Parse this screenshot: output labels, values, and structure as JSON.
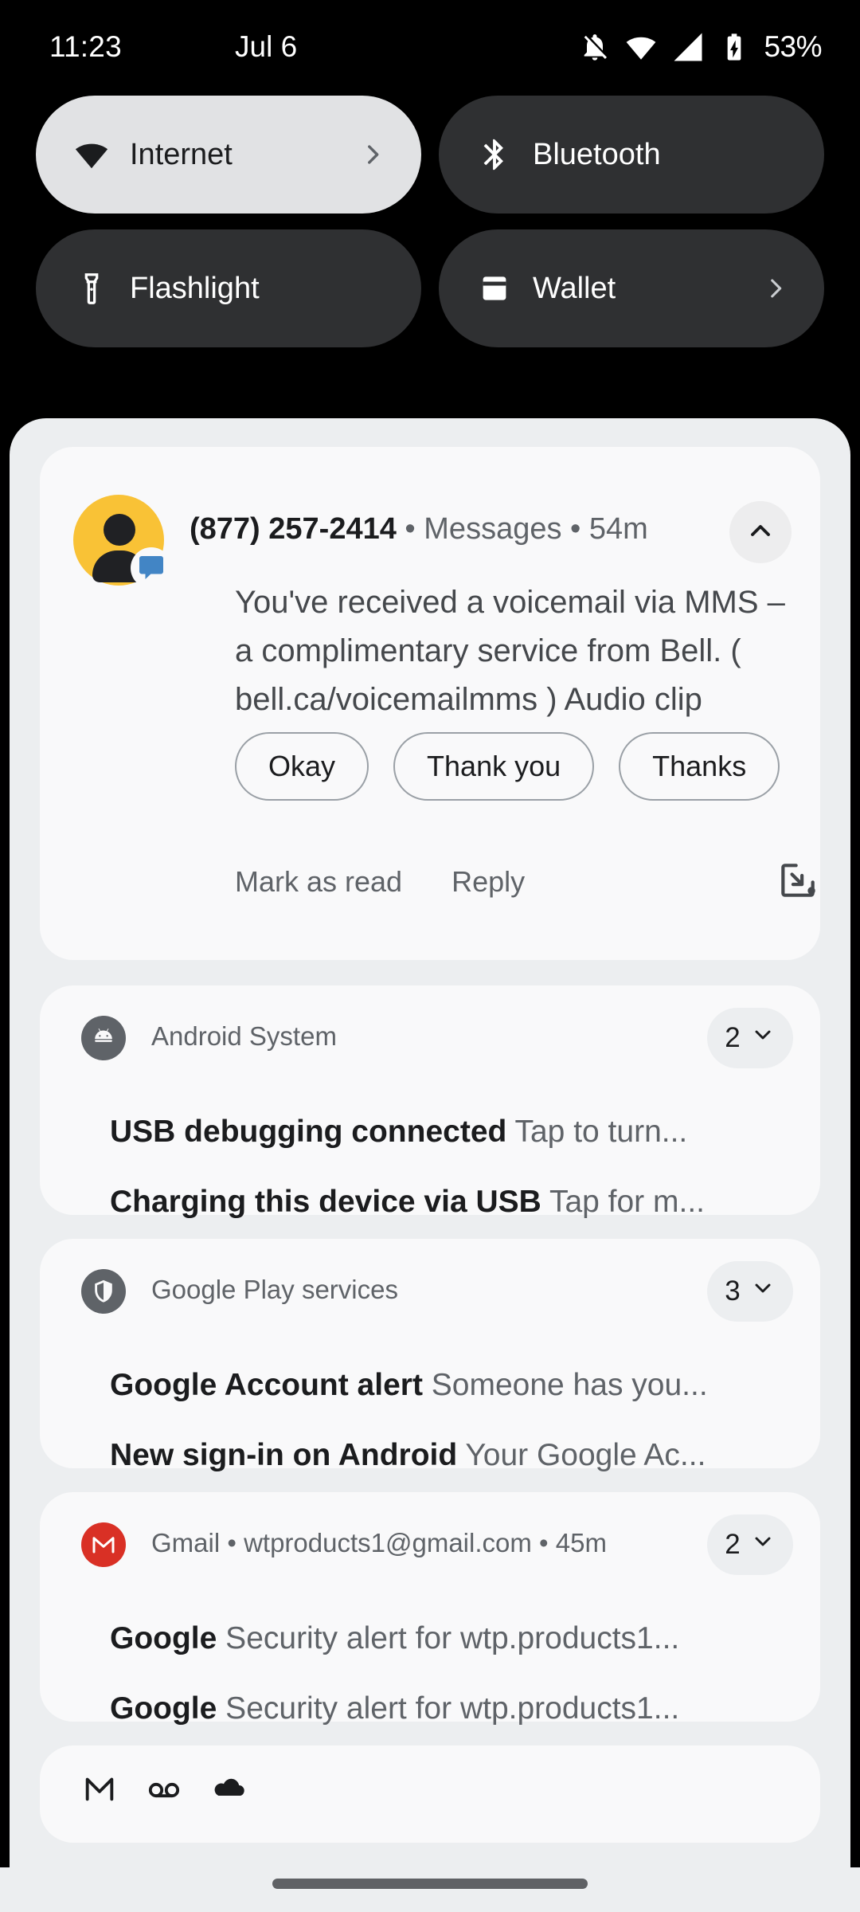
{
  "status_bar": {
    "time": "11:23",
    "date": "Jul 6",
    "battery_percent": "53%",
    "icons": [
      "notifications-off-icon",
      "wifi-icon",
      "signal-icon",
      "battery-charging-icon"
    ]
  },
  "quick_settings": {
    "tiles": [
      {
        "label": "Internet",
        "icon": "wifi-icon",
        "active": true,
        "chevron": true
      },
      {
        "label": "Bluetooth",
        "icon": "bluetooth-icon",
        "active": false,
        "chevron": false
      },
      {
        "label": "Flashlight",
        "icon": "flashlight-icon",
        "active": false,
        "chevron": false
      },
      {
        "label": "Wallet",
        "icon": "wallet-icon",
        "active": false,
        "chevron": true
      }
    ]
  },
  "conversation": {
    "sender": "(877) 257-2414",
    "meta": " • Messages • 54m",
    "avatar_color": "#f9c236",
    "body": "You've received a voicemail via MMS – a complimentary service from Bell. ( bell.ca/voicemailmms ) Audio clip",
    "smart_replies": [
      "Okay",
      "Thank you",
      "Thanks"
    ],
    "actions": {
      "mark_as_read": "Mark as read",
      "reply": "Reply"
    },
    "bubble_icon": "open-in-bubble-icon",
    "collapse_icon": "chevron-up-icon"
  },
  "groups": [
    {
      "app": "Android System",
      "icon": "android-system-icon",
      "icon_color": "#5f6368",
      "count": "2",
      "lines": [
        {
          "title": "USB debugging connected",
          "text": " Tap to turn..."
        },
        {
          "title": "Charging this device via USB",
          "text": " Tap for m..."
        }
      ]
    },
    {
      "app": "Google Play services",
      "icon": "shield-icon",
      "icon_color": "#5f6368",
      "count": "3",
      "lines": [
        {
          "title": "Google Account alert",
          "text": " Someone has you..."
        },
        {
          "title": "New sign-in on Android",
          "text": " Your Google Ac..."
        }
      ]
    },
    {
      "app": "Gmail • wtproducts1@gmail.com • 45m",
      "icon": "gmail-icon",
      "icon_color": "#d93025",
      "count": "2",
      "lines": [
        {
          "title": "Google",
          "text": " Security alert for wtp.products1..."
        },
        {
          "title": "Google",
          "text": " Security alert for wtp.products1..."
        }
      ]
    }
  ],
  "silent_tray": {
    "icons": [
      "gmail-icon",
      "voicemail-icon",
      "cloud-icon"
    ]
  },
  "colors": {
    "shade_bg": "#eceef0",
    "card_bg": "#f9f9fa",
    "tile_active": "#e1e2e4",
    "tile_inactive": "#2f3032",
    "text_primary": "#1b1c1e",
    "text_secondary": "#5f6368",
    "gmail_red": "#d93025",
    "avatar_yellow": "#f9c236",
    "bubble_blue": "#4285c5"
  }
}
